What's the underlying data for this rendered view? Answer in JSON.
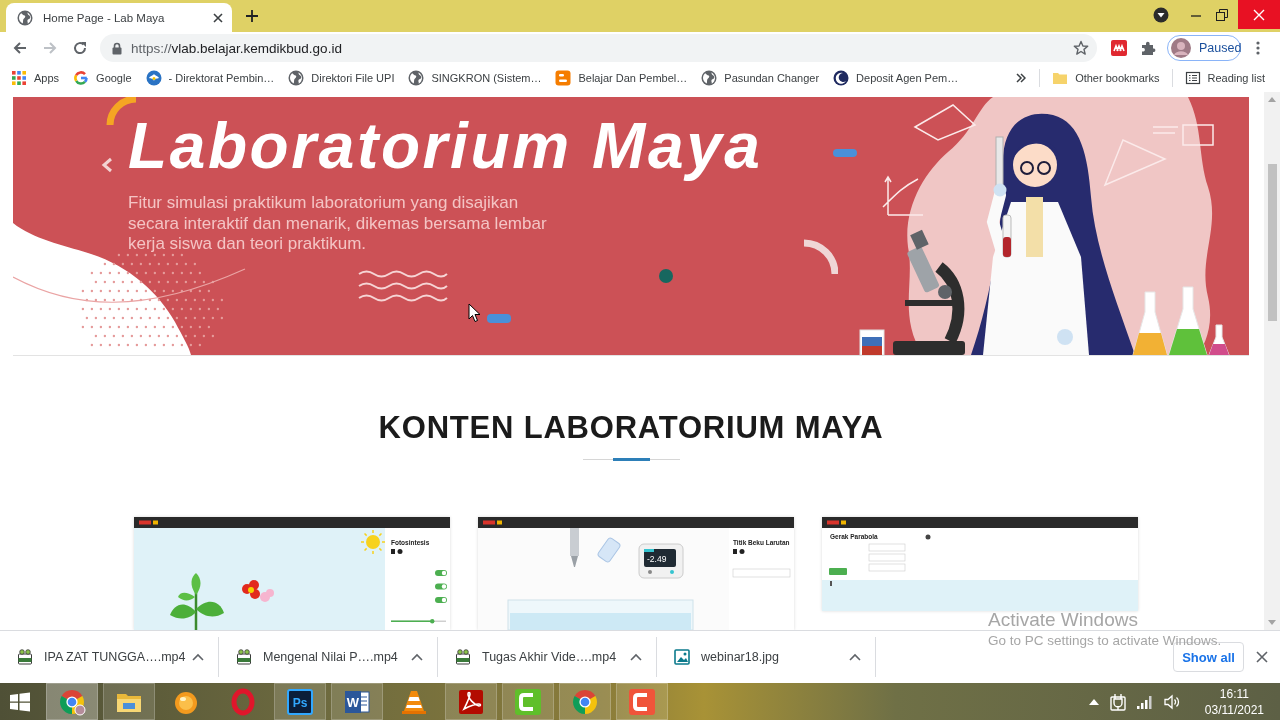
{
  "browser": {
    "tabs": [
      {
        "title": "Home Page - Lab Maya",
        "selected": true
      }
    ],
    "nav": [
      {
        "kind": "back",
        "disabled": false
      },
      {
        "kind": "forward",
        "disabled": true
      },
      {
        "kind": "reload",
        "disabled": false
      }
    ],
    "address": {
      "scheme": "https://",
      "host": "vlab.belajar.kemdikbud.go.id"
    },
    "profile": {
      "label": "Paused"
    }
  },
  "bookmarks": {
    "items": [
      {
        "kind": "apps",
        "label": "Apps"
      },
      {
        "kind": "google",
        "label": "Google"
      },
      {
        "kind": "emblem",
        "label": "- Direktorat Pembin…"
      },
      {
        "kind": "globe",
        "label": "Direktori File UPI"
      },
      {
        "kind": "globe",
        "label": "SINGKRON (Sistem…"
      },
      {
        "kind": "blog",
        "label": "Belajar Dan Pembel…"
      },
      {
        "kind": "globe",
        "label": "Pasundan Changer"
      },
      {
        "kind": "crescent",
        "label": "Deposit Agen Pem…"
      }
    ],
    "other": {
      "label": "Other bookmarks"
    },
    "reading_list": {
      "label": "Reading list"
    }
  },
  "banner": {
    "title": "Laboratorium Maya",
    "description": "Fitur simulasi praktikum laboratorium yang disajikan\nsecara interaktif dan menarik, dikemas bersama lembar\nkerja siswa dan teori praktikum."
  },
  "section": {
    "heading": "KONTEN LABORATORIUM MAYA"
  },
  "cards": [
    {
      "kind": "photosynthesis",
      "title": "Fotosintesis",
      "toggles": [
        {
          "on": true
        },
        {
          "on": true
        },
        {
          "on": true
        }
      ],
      "slider": {
        "level": 0.75
      }
    },
    {
      "kind": "freezing_point",
      "title": "Titik Beku Larutan",
      "reading": "-2.49"
    },
    {
      "kind": "projectile",
      "title": "Gerak Parabola"
    }
  ],
  "downloads": {
    "items": [
      {
        "kind": "video",
        "name": "IPA ZAT TUNGGA….mp4"
      },
      {
        "kind": "video",
        "name": "Mengenal Nilai P….mp4"
      },
      {
        "kind": "video",
        "name": "Tugas Akhir Vide….mp4"
      },
      {
        "kind": "image",
        "name": "webinar18.jpg"
      }
    ],
    "show_all": "Show all"
  },
  "activation_notice": {
    "title": "Activate Windows",
    "hint": "Go to PC settings to activate Windows."
  },
  "taskbar": {
    "apps": [
      {
        "kind": "chrome",
        "running": true,
        "selected": true
      },
      {
        "kind": "explorer",
        "running": true,
        "selected": false
      },
      {
        "kind": "media_player",
        "running": false,
        "selected": false
      },
      {
        "kind": "opera",
        "running": false,
        "selected": false
      },
      {
        "kind": "photoshop",
        "label": "Ps",
        "running": true,
        "selected": false
      },
      {
        "kind": "word",
        "label": "W",
        "running": true,
        "selected": false
      },
      {
        "kind": "vlc",
        "running": false,
        "selected": false
      },
      {
        "kind": "acrobat",
        "running": true,
        "selected": false
      },
      {
        "kind": "camtasia",
        "running": true,
        "selected": false
      },
      {
        "kind": "chrome",
        "running": true,
        "selected": false
      },
      {
        "kind": "recorder",
        "running": true,
        "selected": false
      }
    ],
    "clock": {
      "time": "16:11",
      "date": "03/11/2021"
    }
  }
}
